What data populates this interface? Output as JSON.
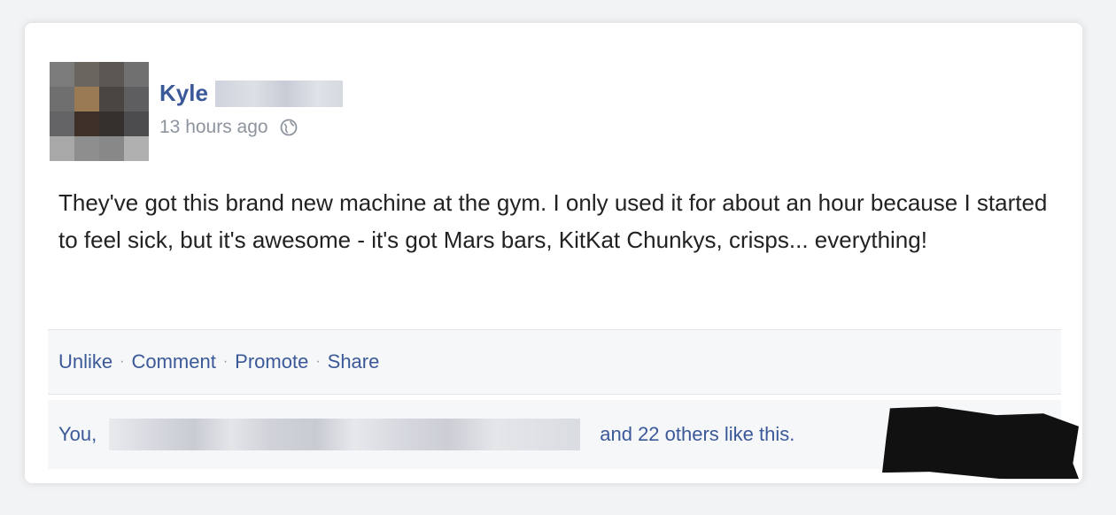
{
  "post": {
    "author_name": "Kyle",
    "timestamp": "13 hours ago",
    "privacy_icon": "globe-icon",
    "text": "They've got this brand new machine at the gym. I only used it for about an hour because I started to feel sick, but it's awesome - it's got Mars bars, KitKat Chunkys, crisps... everything!"
  },
  "actions": {
    "unlike": "Unlike",
    "comment": "Comment",
    "promote": "Promote",
    "share": "Share",
    "separator": "·"
  },
  "likes": {
    "prefix": "You,",
    "suffix": "and 22 others like this."
  },
  "colors": {
    "link": "#3b5998",
    "meta": "#8d949e",
    "text": "#222222"
  }
}
